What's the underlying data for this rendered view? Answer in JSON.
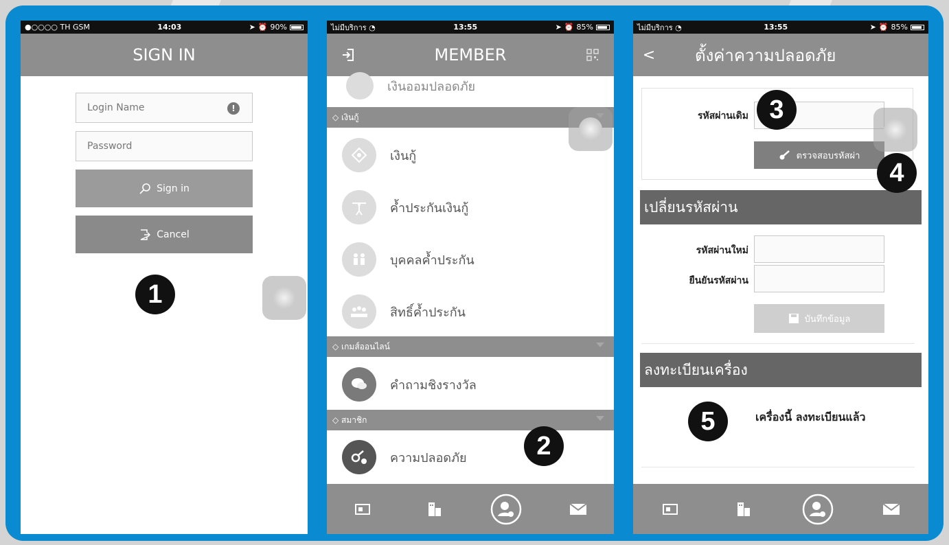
{
  "screen1": {
    "status": {
      "carrier": "●○○○○ TH GSM",
      "time": "14:03",
      "battery": "90%"
    },
    "title": "SIGN IN",
    "login_placeholder": "Login Name",
    "password_placeholder": "Password",
    "signin_label": "Sign in",
    "cancel_label": "Cancel",
    "step_number": "1"
  },
  "screen2": {
    "status": {
      "carrier": "ไม่มีบริการ",
      "time": "13:55",
      "battery": "85%"
    },
    "title": "MEMBER",
    "top_partial_item": "เงินออมปลอดภัย",
    "sections": [
      {
        "label": "เงินกู้"
      },
      {
        "label": "เกมส์ออนไลน์"
      },
      {
        "label": "สมาชิก"
      }
    ],
    "items": [
      {
        "label": "เงินกู้"
      },
      {
        "label": "ค้ำประกันเงินกู้"
      },
      {
        "label": "บุคคลค้ำประกัน"
      },
      {
        "label": "สิทธิ์ค้ำประกัน"
      },
      {
        "label": "คำถามชิงรางวัล"
      },
      {
        "label": "ความปลอดภัย"
      }
    ],
    "step_number": "2"
  },
  "screen3": {
    "status": {
      "carrier": "ไม่มีบริการ",
      "time": "13:55",
      "battery": "85%"
    },
    "back": "<",
    "title": "ตั้งค่าความปลอดภัย",
    "old_password_label": "รหัสผ่านเดิม",
    "verify_label": "ตรวจสอบรหัสผ่า",
    "change_header": "เปลี่ยนรหัสผ่าน",
    "new_password_label": "รหัสผ่านใหม่",
    "confirm_password_label": "ยืนยันรหัสผ่าน",
    "save_label": "บันทึกข้อมูล",
    "register_header": "ลงทะเบียนเครื่อง",
    "register_status": "เครื่องนี้ ลงทะเบียนแล้ว",
    "step3": "3",
    "step4": "4",
    "step5": "5"
  }
}
